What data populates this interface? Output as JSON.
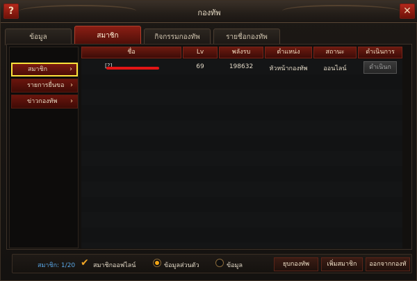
{
  "window": {
    "title": "กองทัพ",
    "help_label": "?",
    "close_label": "✕"
  },
  "tabs": [
    {
      "label": "ข้อมูล"
    },
    {
      "label": "สมาชิก",
      "active": true
    },
    {
      "label": "กิจกรรมกองทัพ"
    },
    {
      "label": "รายชื่อกองทัพ"
    }
  ],
  "sidebar": {
    "items": [
      {
        "label": "สมาชิก",
        "active": true
      },
      {
        "label": "รายการยื่นขอ"
      },
      {
        "label": "ข่าวกองทัพ"
      }
    ],
    "chevron": "›"
  },
  "table": {
    "headers": [
      "ชื่อ",
      "Lv",
      "พลังรบ",
      "ตำแหน่ง",
      "สถานะ",
      "ดำเนินการ"
    ],
    "rows": [
      {
        "name_prefix": "[?]",
        "lv": "69",
        "power": "198632",
        "rank": "หัวหน้ากองทัพ",
        "status": "ออนไลน์",
        "action": "ดำเนินก"
      }
    ]
  },
  "footer": {
    "count": "สมาชิก: 1/20",
    "checkbox_label": "สมาชิกออฟไลน์",
    "radio1_label": "ข้อมูลส่วนตัว",
    "radio2_label": "ข้อมูล",
    "buttons": [
      "ยุบกองทัพ",
      "เพิ่มสมาชิก",
      "ออกจากกองทั"
    ]
  },
  "icons": {
    "check": "check-icon",
    "chevron": "chevron-right-icon"
  },
  "colors": {
    "accent_red": "#7a1a10",
    "highlight": "#ffe33b",
    "radio_on": "#f3a515",
    "count_text": "#5aa7e6"
  }
}
